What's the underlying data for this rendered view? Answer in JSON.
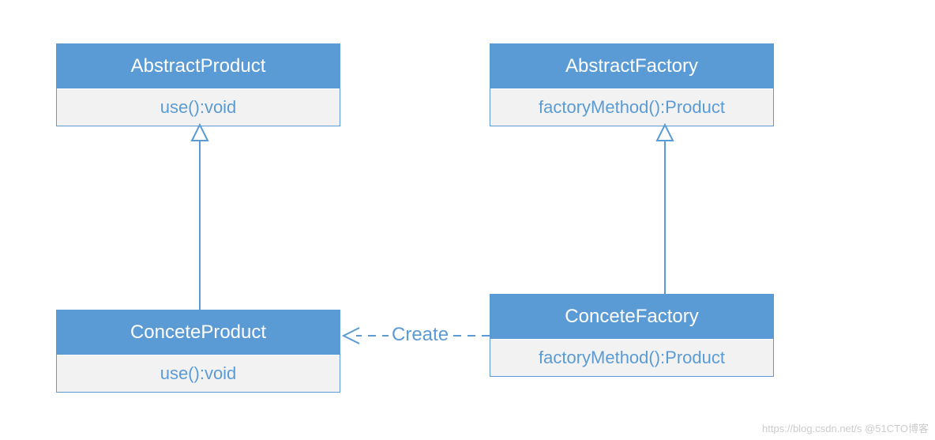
{
  "diagram": {
    "abstractProduct": {
      "name": "AbstractProduct",
      "member": "use():void"
    },
    "abstractFactory": {
      "name": "AbstractFactory",
      "member": "factoryMethod():Product"
    },
    "concreteProduct": {
      "name": "ConceteProduct",
      "member": "use():void"
    },
    "concreteFactory": {
      "name": "ConceteFactory",
      "member": "factoryMethod():Product"
    },
    "dependencyLabel": "Create"
  },
  "watermark": "https://blog.csdn.net/s  @51CTO博客",
  "colors": {
    "primary": "#5b9bd5",
    "memberBg": "#f2f2f2",
    "text": "#ffffff"
  }
}
